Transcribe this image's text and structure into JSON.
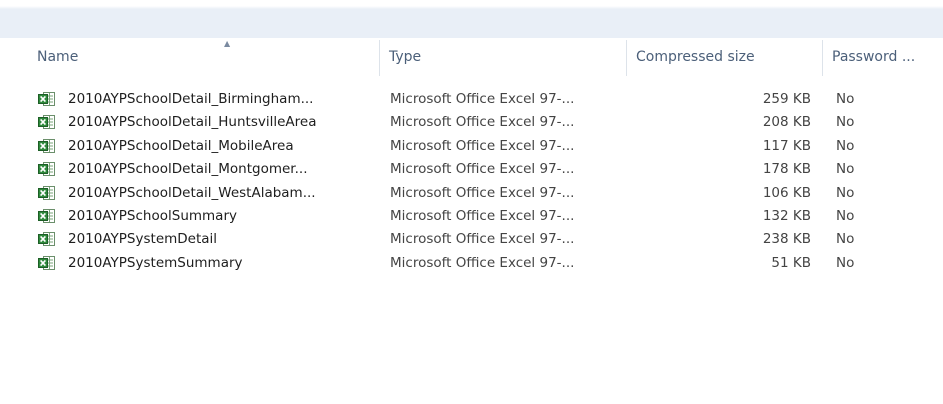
{
  "columns": [
    {
      "label": "Name"
    },
    {
      "label": "Type"
    },
    {
      "label": "Compressed size"
    },
    {
      "label": "Password ..."
    }
  ],
  "sort_indicator_icon": "sort-ascending-icon",
  "file_icon": "excel-file-icon",
  "files": [
    {
      "name": "2010AYPSchoolDetail_Birmingham...",
      "type": "Microsoft Office Excel 97-...",
      "size": "259 KB",
      "password": "No"
    },
    {
      "name": "2010AYPSchoolDetail_HuntsvilleArea",
      "type": "Microsoft Office Excel 97-...",
      "size": "208 KB",
      "password": "No"
    },
    {
      "name": "2010AYPSchoolDetail_MobileArea",
      "type": "Microsoft Office Excel 97-...",
      "size": "117 KB",
      "password": "No"
    },
    {
      "name": "2010AYPSchoolDetail_Montgomer...",
      "type": "Microsoft Office Excel 97-...",
      "size": "178 KB",
      "password": "No"
    },
    {
      "name": "2010AYPSchoolDetail_WestAlabam...",
      "type": "Microsoft Office Excel 97-...",
      "size": "106 KB",
      "password": "No"
    },
    {
      "name": "2010AYPSchoolSummary",
      "type": "Microsoft Office Excel 97-...",
      "size": "132 KB",
      "password": "No"
    },
    {
      "name": "2010AYPSystemDetail",
      "type": "Microsoft Office Excel 97-...",
      "size": "238 KB",
      "password": "No"
    },
    {
      "name": "2010AYPSystemSummary",
      "type": "Microsoft Office Excel 97-...",
      "size": "51 KB",
      "password": "No"
    }
  ]
}
